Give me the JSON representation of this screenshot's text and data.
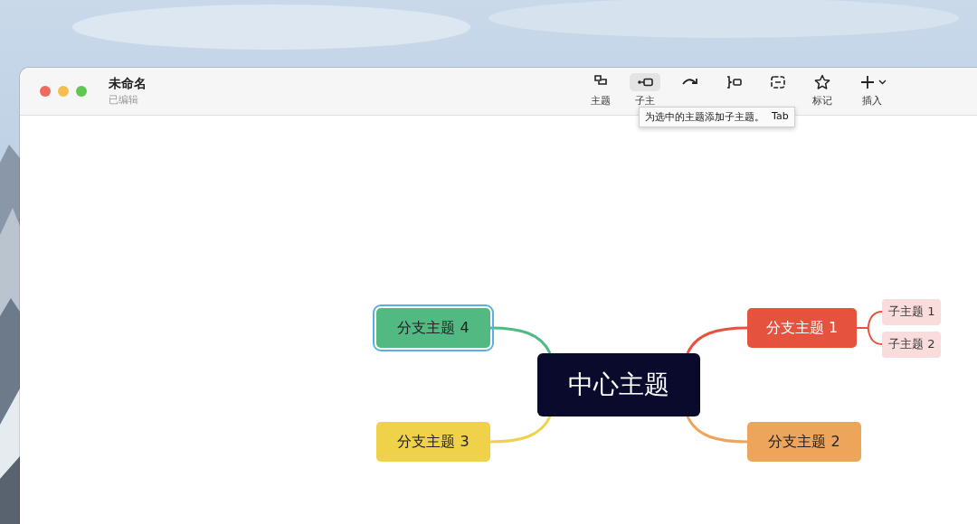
{
  "window": {
    "title": "未命名",
    "subtitle": "已编辑",
    "traffic_lights": [
      {
        "color": "#ec6a5e"
      },
      {
        "color": "#f4bf4f"
      },
      {
        "color": "#61c554"
      }
    ]
  },
  "toolbar": [
    {
      "kind": "topic",
      "label": "主题",
      "hovered": false
    },
    {
      "kind": "subtopic",
      "label": "子主",
      "hovered": true
    },
    {
      "kind": "relationship",
      "hovered": false
    },
    {
      "kind": "summary",
      "hovered": false
    },
    {
      "kind": "boundary",
      "hovered": false
    },
    {
      "kind": "marker",
      "label": "标记",
      "hovered": false
    },
    {
      "kind": "insert",
      "label": "插入",
      "hovered": false
    }
  ],
  "tooltip": {
    "text": "为选中的主题添加子主题。",
    "shortcut": "Tab"
  },
  "mindmap": {
    "central": "中心主题",
    "branches": [
      {
        "label": "分支主题 4",
        "color": "#52b983",
        "selected": true
      },
      {
        "label": "分支主题 3",
        "color": "#efd24a",
        "selected": false
      },
      {
        "label": "分支主题 1",
        "color": "#e5533f",
        "selected": false,
        "children": [
          {
            "label": "子主题 1"
          },
          {
            "label": "子主题 2"
          }
        ]
      },
      {
        "label": "分支主题 2",
        "color": "#eca55a",
        "selected": false
      }
    ]
  }
}
